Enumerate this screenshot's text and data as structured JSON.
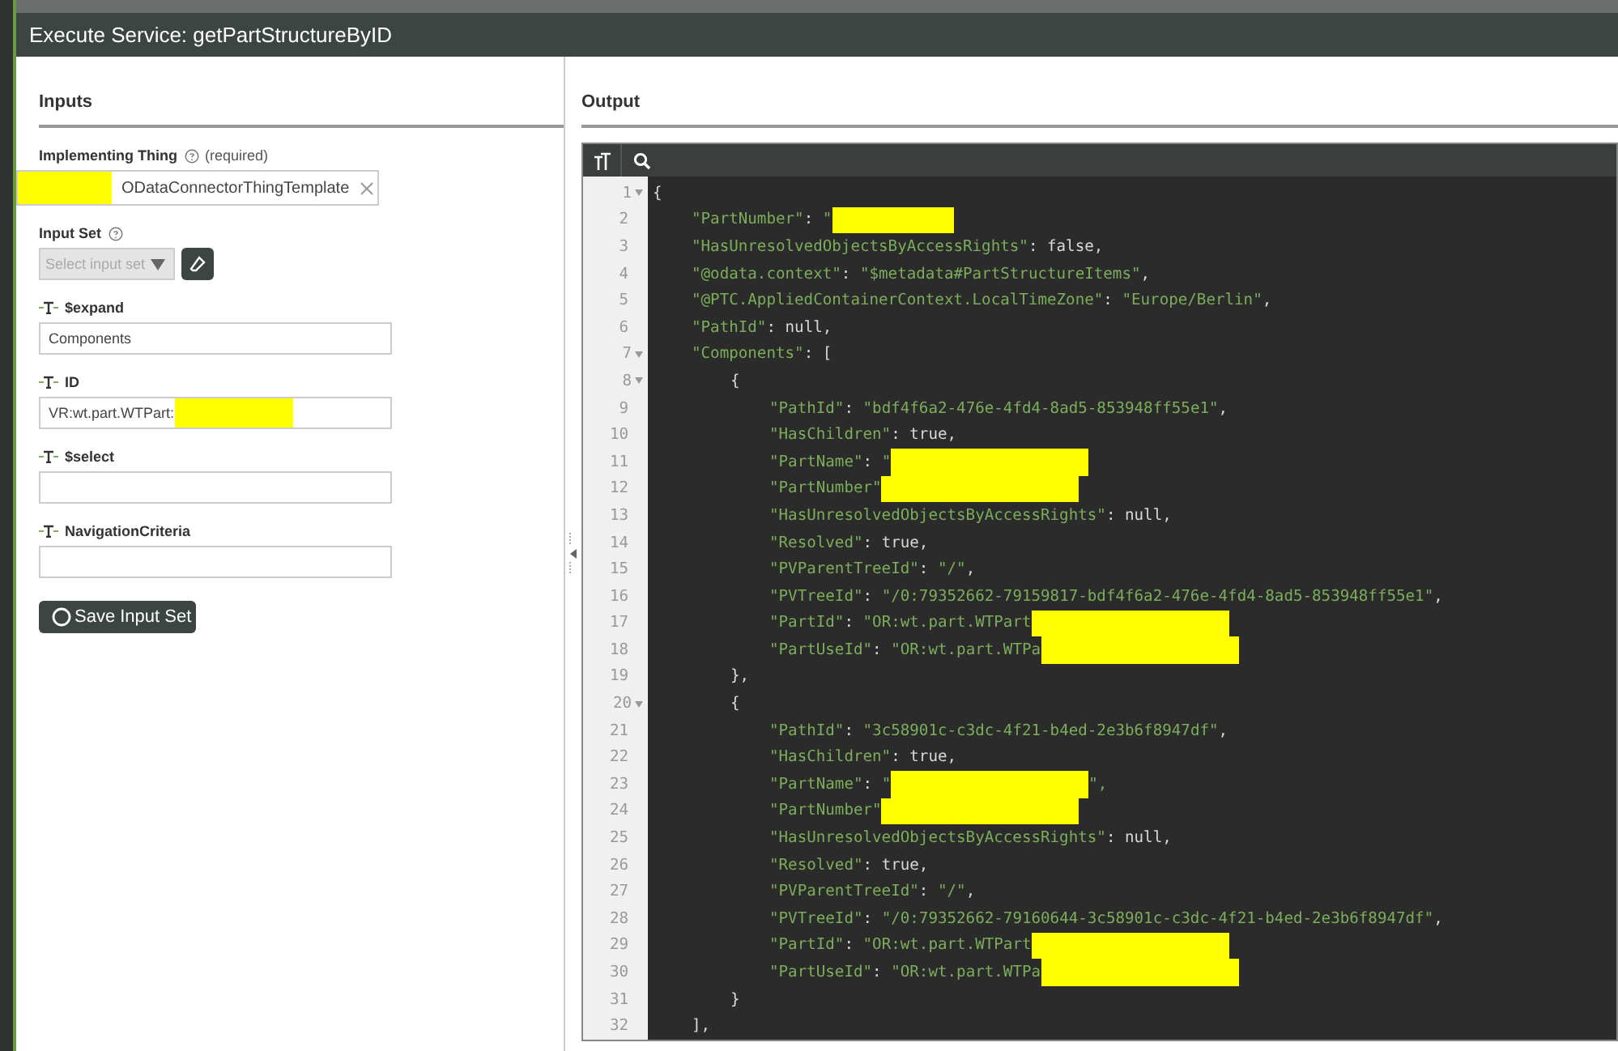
{
  "dialog": {
    "title": "Execute Service: getPartStructureByID"
  },
  "inputs": {
    "heading": "Inputs",
    "implementing_thing": {
      "label": "Implementing Thing",
      "note": "(required)",
      "value": "ODataConnectorThingTemplate",
      "redacted": true
    },
    "input_set": {
      "label": "Input Set",
      "placeholder": "Select input set",
      "disabled": true
    },
    "params": [
      {
        "label": "$expand",
        "value": "Components",
        "redacted": false
      },
      {
        "label": "ID",
        "value": "VR:wt.part.WTPart:",
        "redacted": true
      },
      {
        "label": "$select",
        "redacted": false
      },
      {
        "label": "NavigationCriteria",
        "redacted": false
      }
    ],
    "save_button": "Save Input Set"
  },
  "output": {
    "heading": "Output",
    "lines": [
      {
        "n": "1",
        "fold": true,
        "text": "{"
      },
      {
        "n": "2",
        "fold": false,
        "text": "\"PartNumber\": \"",
        "redacted": true
      },
      {
        "n": "3",
        "fold": false,
        "text": "\"HasUnresolvedObjectsByAccessRights\": false,"
      },
      {
        "n": "4",
        "fold": false,
        "text": "\"@odata.context\": \"$metadata#PartStructureItems\","
      },
      {
        "n": "5",
        "fold": false,
        "text": "\"@PTC.AppliedContainerContext.LocalTimeZone\": \"Europe/Berlin\","
      },
      {
        "n": "6",
        "fold": false,
        "text": "\"PathId\": null,"
      },
      {
        "n": "7",
        "fold": true,
        "text": "\"Components\": ["
      },
      {
        "n": "8",
        "fold": true,
        "text": "{"
      },
      {
        "n": "9",
        "fold": false,
        "text": "\"PathId\": \"bdf4f6a2-476e-4fd4-8ad5-853948ff55e1\","
      },
      {
        "n": "10",
        "fold": false,
        "text": "\"HasChildren\": true,"
      },
      {
        "n": "11",
        "fold": false,
        "text": "\"PartName\": \"",
        "redacted": true
      },
      {
        "n": "12",
        "fold": false,
        "text": "\"PartNumber\"",
        "redacted": true
      },
      {
        "n": "13",
        "fold": false,
        "text": "\"HasUnresolvedObjectsByAccessRights\": null,"
      },
      {
        "n": "14",
        "fold": false,
        "text": "\"Resolved\": true,"
      },
      {
        "n": "15",
        "fold": false,
        "text": "\"PVParentTreeId\": \"/\","
      },
      {
        "n": "16",
        "fold": false,
        "text": "\"PVTreeId\": \"/0:79352662-79159817-bdf4f6a2-476e-4fd4-8ad5-853948ff55e1\","
      },
      {
        "n": "17",
        "fold": false,
        "text": "\"PartId\": \"OR:wt.part.WTPart",
        "redacted": true
      },
      {
        "n": "18",
        "fold": false,
        "text": "\"PartUseId\": \"OR:wt.part.WTPa",
        "redacted": true
      },
      {
        "n": "19",
        "fold": false,
        "text": "},"
      },
      {
        "n": "20",
        "fold": true,
        "text": "{"
      },
      {
        "n": "21",
        "fold": false,
        "text": "\"PathId\": \"3c58901c-c3dc-4f21-b4ed-2e3b6f8947df\","
      },
      {
        "n": "22",
        "fold": false,
        "text": "\"HasChildren\": true,"
      },
      {
        "n": "23",
        "fold": false,
        "text": "\"PartName\": \"",
        "redacted": true,
        "after": "\","
      },
      {
        "n": "24",
        "fold": false,
        "text": "\"PartNumber\"",
        "redacted": true
      },
      {
        "n": "25",
        "fold": false,
        "text": "\"HasUnresolvedObjectsByAccessRights\": null,"
      },
      {
        "n": "26",
        "fold": false,
        "text": "\"Resolved\": true,"
      },
      {
        "n": "27",
        "fold": false,
        "text": "\"PVParentTreeId\": \"/\","
      },
      {
        "n": "28",
        "fold": false,
        "text": "\"PVTreeId\": \"/0:79352662-79160644-3c58901c-c3dc-4f21-b4ed-2e3b6f8947df\","
      },
      {
        "n": "29",
        "fold": false,
        "text": "\"PartId\": \"OR:wt.part.WTPart",
        "redacted": true
      },
      {
        "n": "30",
        "fold": false,
        "text": "\"PartUseId\": \"OR:wt.part.WTPa",
        "redacted": true
      },
      {
        "n": "31",
        "fold": false,
        "text": "}"
      },
      {
        "n": "32",
        "fold": false,
        "text": "],"
      }
    ]
  }
}
